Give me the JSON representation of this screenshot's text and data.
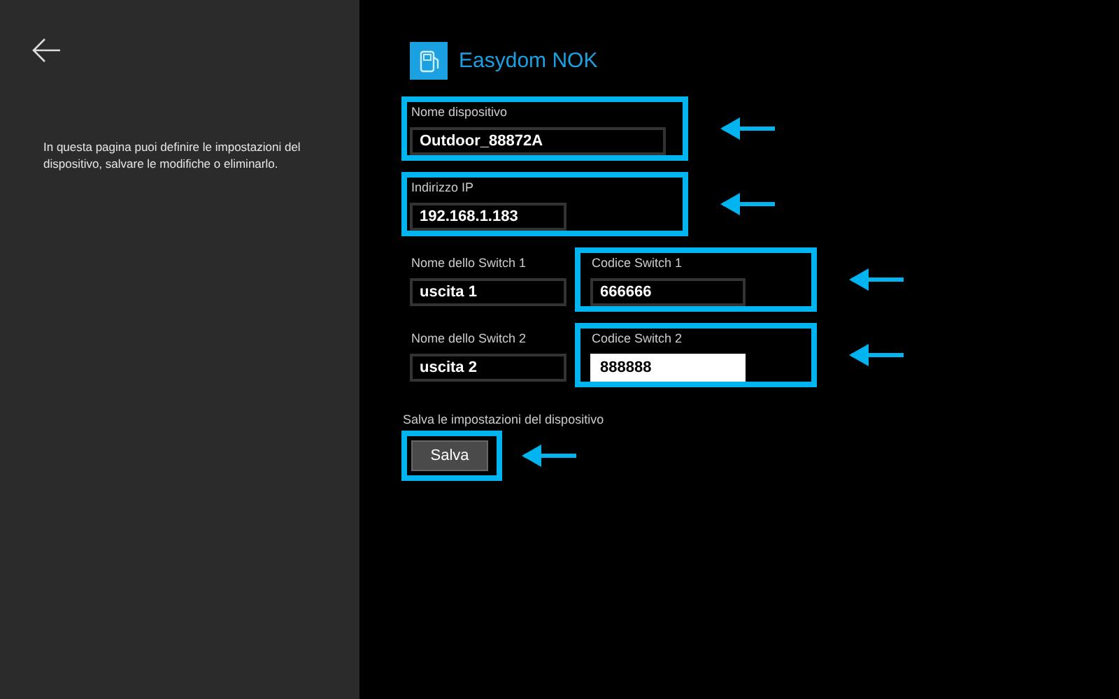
{
  "sidebar": {
    "description": "In questa pagina puoi definire le impostazioni del dispositivo, salvare le modifiche o eliminarlo."
  },
  "header": {
    "title": "Easydom NOK"
  },
  "rows": [
    {
      "fields": [
        {
          "label": "Nome dispositivo",
          "value": "Outdoor_88872A",
          "highlighted": true,
          "focused": false
        }
      ]
    },
    {
      "fields": [
        {
          "label": "Indirizzo IP",
          "value": "192.168.1.183",
          "highlighted": true,
          "focused": false
        }
      ]
    },
    {
      "fields": [
        {
          "label": "Nome dello Switch 1",
          "value": "uscita 1",
          "highlighted": false,
          "focused": false
        },
        {
          "label": "Codice Switch 1",
          "value": "666666",
          "highlighted": true,
          "focused": false
        }
      ]
    },
    {
      "fields": [
        {
          "label": "Nome dello Switch 2",
          "value": "uscita 2",
          "highlighted": false,
          "focused": false
        },
        {
          "label": "Codice Switch 2",
          "value": "888888",
          "highlighted": true,
          "focused": true
        }
      ]
    }
  ],
  "save": {
    "caption": "Salva le impostazioni del dispositivo",
    "button": "Salva",
    "highlighted": true
  }
}
